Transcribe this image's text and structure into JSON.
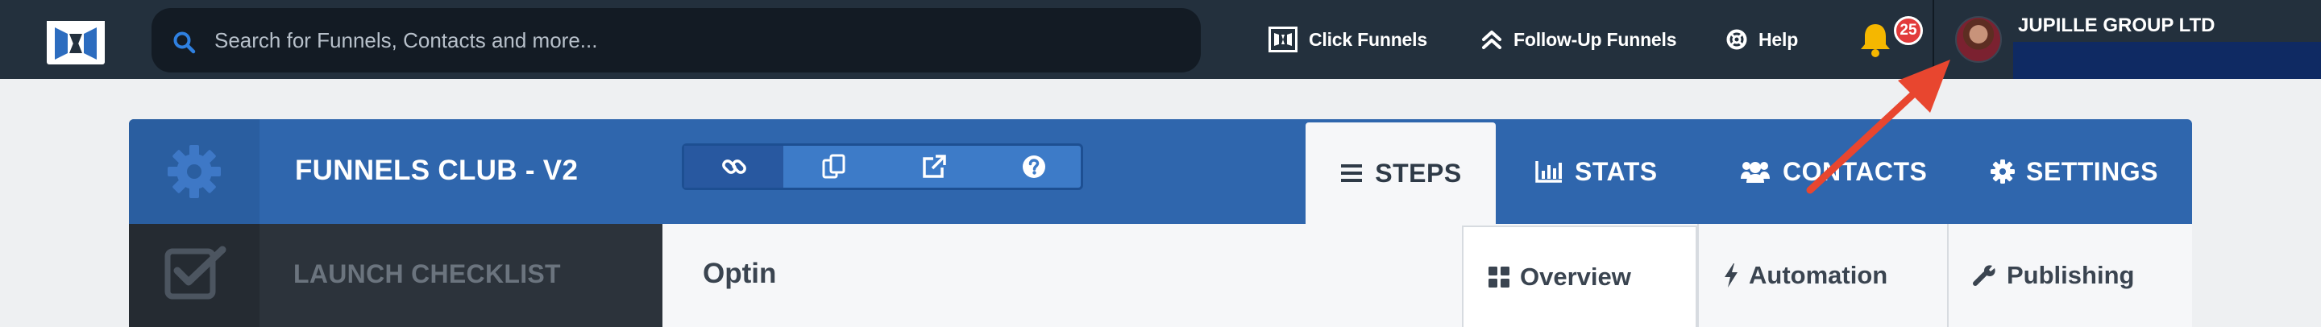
{
  "topbar": {
    "logo_icon": "clickfunnels-logo-icon",
    "search": {
      "placeholder": "Search for Funnels, Contacts and more..."
    },
    "links": [
      {
        "label": "Click Funnels",
        "icon": "clickfunnels-icon"
      },
      {
        "label": "Follow-Up Funnels",
        "icon": "double-chevron-up-icon"
      },
      {
        "label": "Help",
        "icon": "lifebuoy-icon"
      }
    ],
    "notifications": {
      "icon": "bell-icon",
      "count": "25"
    },
    "account": {
      "name": "JUPILLE GROUP LTD",
      "avatar": "avatar"
    }
  },
  "funnel": {
    "settings_icon": "gear-icon",
    "title": "FUNNELS CLUB - V2",
    "tools": [
      {
        "icon": "link-icon"
      },
      {
        "icon": "copy-icon"
      },
      {
        "icon": "external-link-icon"
      },
      {
        "icon": "question-icon"
      }
    ],
    "tabs": [
      {
        "label": "STEPS",
        "icon": "list-icon",
        "active": true
      },
      {
        "label": "STATS",
        "icon": "bar-chart-icon"
      },
      {
        "label": "CONTACTS",
        "icon": "users-icon"
      },
      {
        "label": "SETTINGS",
        "icon": "gear-icon"
      }
    ]
  },
  "sidebar": {
    "checklist_label": "LAUNCH CHECKLIST",
    "checklist_icon": "checkbox-icon"
  },
  "step": {
    "name": "Optin",
    "tabs": [
      {
        "label": "Overview",
        "icon": "grid-icon",
        "active": true
      },
      {
        "label": "Automation",
        "icon": "bolt-icon"
      },
      {
        "label": "Publishing",
        "icon": "wrench-icon"
      }
    ]
  },
  "colors": {
    "topbar": "#23303d",
    "header_blue": "#2f66ad",
    "sidebar_dark": "#2c333b",
    "badge_red": "#e23b3b",
    "bell_yellow": "#f5b700",
    "arrow_red": "#e8462f"
  }
}
